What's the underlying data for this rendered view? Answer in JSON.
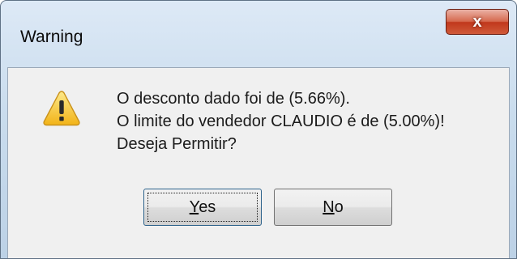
{
  "window": {
    "title": "Warning",
    "close_glyph": "x"
  },
  "message": {
    "line1": "O desconto dado foi de (5.66%).",
    "line2": "O limite do vendedor CLAUDIO é de (5.00%)!",
    "line3": "Deseja Permitir?"
  },
  "icon": "warning-triangle-icon",
  "buttons": {
    "yes": {
      "mnemonic": "Y",
      "rest": "es"
    },
    "no": {
      "mnemonic": "N",
      "rest": "o"
    }
  },
  "colors": {
    "close_button": "#c1381c",
    "warning_yellow": "#f7c52b"
  }
}
